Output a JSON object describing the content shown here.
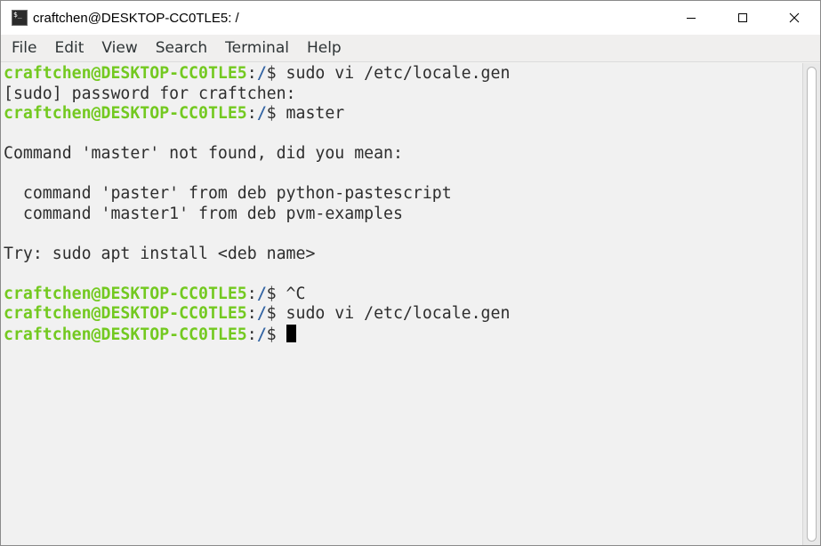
{
  "window": {
    "title": "craftchen@DESKTOP-CC0TLE5: /",
    "icon": "terminal-icon"
  },
  "controls": {
    "minimize": "minimize-icon",
    "maximize": "maximize-icon",
    "close": "close-icon"
  },
  "menu": [
    "File",
    "Edit",
    "View",
    "Search",
    "Terminal",
    "Help"
  ],
  "terminal": {
    "colors": {
      "prompt_user": "#73c920",
      "prompt_path": "#3465a4",
      "text": "#2e2e2e",
      "background": "#f1f1f1"
    },
    "lines": [
      {
        "type": "prompt",
        "user": "craftchen@DESKTOP-CC0TLE5",
        "sep": ":",
        "path": "/",
        "cmd": "$ sudo vi /etc/locale.gen"
      },
      {
        "type": "output",
        "text": "[sudo] password for craftchen:"
      },
      {
        "type": "prompt",
        "user": "craftchen@DESKTOP-CC0TLE5",
        "sep": ":",
        "path": "/",
        "cmd": "$ master"
      },
      {
        "type": "output",
        "text": ""
      },
      {
        "type": "output",
        "text": "Command 'master' not found, did you mean:"
      },
      {
        "type": "output",
        "text": ""
      },
      {
        "type": "output",
        "text": "  command 'paster' from deb python-pastescript"
      },
      {
        "type": "output",
        "text": "  command 'master1' from deb pvm-examples"
      },
      {
        "type": "output",
        "text": ""
      },
      {
        "type": "output",
        "text": "Try: sudo apt install <deb name>"
      },
      {
        "type": "output",
        "text": ""
      },
      {
        "type": "prompt",
        "user": "craftchen@DESKTOP-CC0TLE5",
        "sep": ":",
        "path": "/",
        "cmd": "$ ^C"
      },
      {
        "type": "prompt",
        "user": "craftchen@DESKTOP-CC0TLE5",
        "sep": ":",
        "path": "/",
        "cmd": "$ sudo vi /etc/locale.gen"
      },
      {
        "type": "prompt",
        "user": "craftchen@DESKTOP-CC0TLE5",
        "sep": ":",
        "path": "/",
        "cmd": "$ ",
        "cursor": true
      }
    ]
  }
}
